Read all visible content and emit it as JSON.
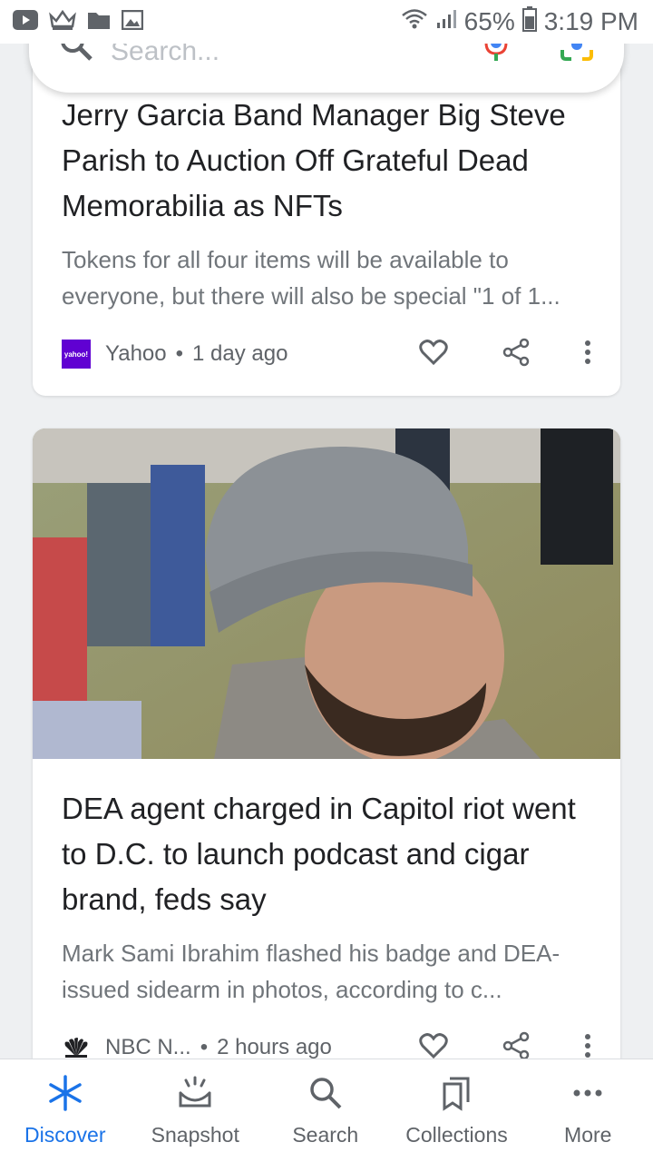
{
  "status_bar": {
    "battery": "65%",
    "time": "3:19 PM"
  },
  "search": {
    "placeholder": "Search..."
  },
  "cards": [
    {
      "title": "Jerry Garcia Band Manager Big Steve Parish to Auction Off Grateful Dead Memorabilia as NFTs",
      "snippet": "Tokens for all four items will be available to everyone, but there will also be special \"1 of 1...",
      "source": "Yahoo",
      "source_logo_text": "yahoo!",
      "time": "1 day ago"
    },
    {
      "title": "DEA agent charged in Capitol riot went to D.C. to launch podcast and cigar brand, feds say",
      "snippet": "Mark Sami Ibrahim flashed his badge and DEA-issued sidearm in photos, according to c...",
      "source": "NBC N...",
      "time": "2 hours ago"
    }
  ],
  "separator": "•",
  "nav": [
    {
      "label": "Discover",
      "icon": "asterisk-icon"
    },
    {
      "label": "Snapshot",
      "icon": "snapshot-icon"
    },
    {
      "label": "Search",
      "icon": "search-icon"
    },
    {
      "label": "Collections",
      "icon": "bookmarks-icon"
    },
    {
      "label": "More",
      "icon": "more-horizontal-icon"
    }
  ],
  "colors": {
    "accent": "#1a73e8",
    "yahoo": "#6001d2"
  }
}
